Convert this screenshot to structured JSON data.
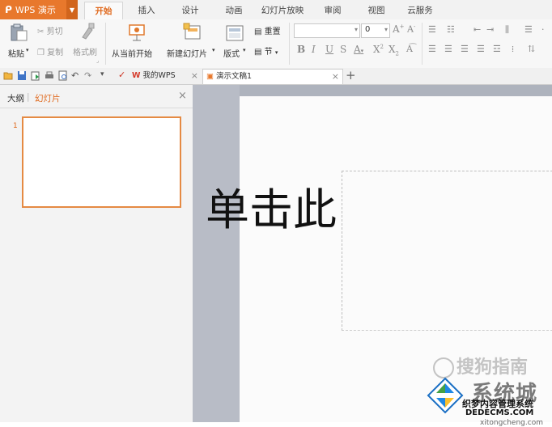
{
  "app": {
    "name": "WPS 演示"
  },
  "ribbon_tabs": [
    "开始",
    "插入",
    "设计",
    "动画",
    "幻灯片放映",
    "审阅",
    "视图",
    "云服务"
  ],
  "active_tab": "开始",
  "toolbar": {
    "paste": "粘贴",
    "cut": "剪切",
    "copy": "复制",
    "format_painter": "格式刷",
    "from_current": "从当前开始",
    "new_slide": "新建幻灯片",
    "layout": "版式",
    "reset": "重置",
    "section": "节",
    "font_size": "0"
  },
  "doc_tabs": {
    "mywps": "我的WPS",
    "document": "演示文稿1"
  },
  "panel": {
    "outline_tab": "大纲",
    "slides_tab": "幻灯片",
    "slide_number": "1"
  },
  "slide": {
    "title_text": "单击此"
  },
  "watermarks": {
    "sogou": "搜狗指南",
    "site": "系统城",
    "cms": "织梦内容管理系统",
    "domain": "DEDECMS.COM",
    "domain2": "xitongcheng.com"
  },
  "colors": {
    "accent": "#e8782c",
    "active_tab_text": "#e06a1f"
  }
}
